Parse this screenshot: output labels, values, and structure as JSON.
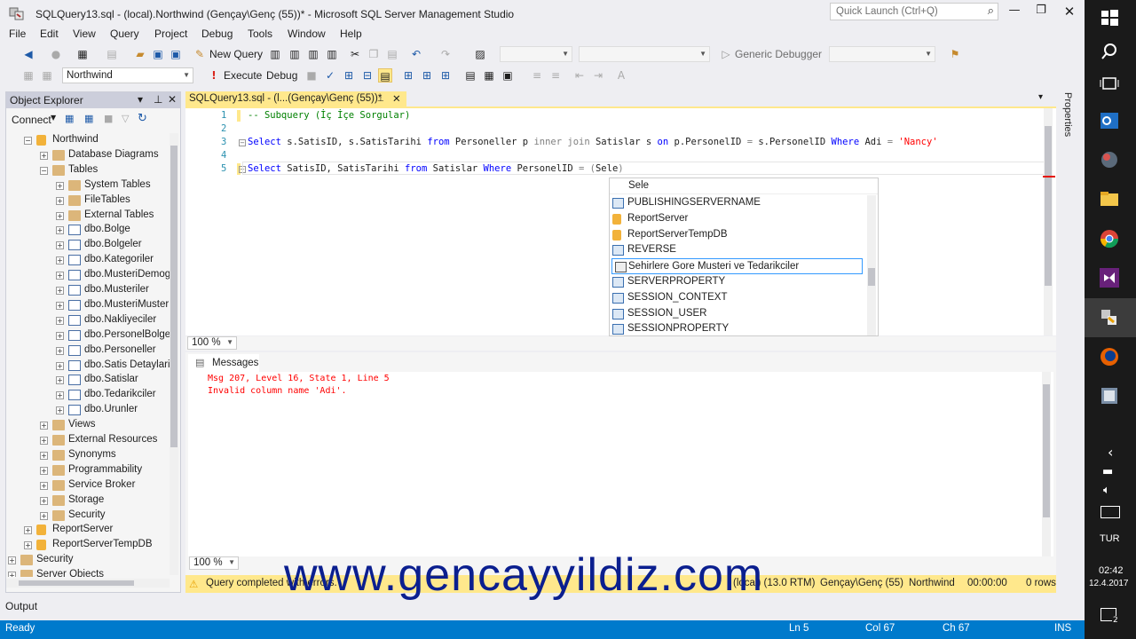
{
  "window": {
    "title": "SQLQuery13.sql - (local).Northwind (Gençay\\Genç (55))* - Microsoft SQL Server Management Studio",
    "quick_launch_placeholder": "Quick Launch (Ctrl+Q)"
  },
  "menu": [
    "File",
    "Edit",
    "View",
    "Query",
    "Project",
    "Debug",
    "Tools",
    "Window",
    "Help"
  ],
  "toolbar1": {
    "new_query": "New Query",
    "debugger": "Generic Debugger"
  },
  "toolbar2": {
    "database": "Northwind",
    "execute": "Execute",
    "debug": "Debug"
  },
  "object_explorer": {
    "title": "Object Explorer",
    "connect": "Connect",
    "tree": [
      {
        "label": "Northwind",
        "level": 1,
        "expanded": true,
        "icon": "database-icon"
      },
      {
        "label": "Database Diagrams",
        "level": 2,
        "expanded": false,
        "icon": "folder-icon"
      },
      {
        "label": "Tables",
        "level": 2,
        "expanded": true,
        "icon": "folder-icon"
      },
      {
        "label": "System Tables",
        "level": 3,
        "expanded": false,
        "icon": "folder-icon"
      },
      {
        "label": "FileTables",
        "level": 3,
        "expanded": false,
        "icon": "folder-icon"
      },
      {
        "label": "External Tables",
        "level": 3,
        "expanded": false,
        "icon": "folder-icon"
      },
      {
        "label": "dbo.Bolge",
        "level": 3,
        "expanded": false,
        "icon": "table-icon"
      },
      {
        "label": "dbo.Bolgeler",
        "level": 3,
        "expanded": false,
        "icon": "table-icon"
      },
      {
        "label": "dbo.Kategoriler",
        "level": 3,
        "expanded": false,
        "icon": "table-icon"
      },
      {
        "label": "dbo.MusteriDemog",
        "level": 3,
        "expanded": false,
        "icon": "table-icon"
      },
      {
        "label": "dbo.Musteriler",
        "level": 3,
        "expanded": false,
        "icon": "table-icon"
      },
      {
        "label": "dbo.MusteriMuster",
        "level": 3,
        "expanded": false,
        "icon": "table-icon"
      },
      {
        "label": "dbo.Nakliyeciler",
        "level": 3,
        "expanded": false,
        "icon": "table-icon"
      },
      {
        "label": "dbo.PersonelBolgel",
        "level": 3,
        "expanded": false,
        "icon": "table-icon"
      },
      {
        "label": "dbo.Personeller",
        "level": 3,
        "expanded": false,
        "icon": "table-icon"
      },
      {
        "label": "dbo.Satis Detaylari",
        "level": 3,
        "expanded": false,
        "icon": "table-icon"
      },
      {
        "label": "dbo.Satislar",
        "level": 3,
        "expanded": false,
        "icon": "table-icon"
      },
      {
        "label": "dbo.Tedarikciler",
        "level": 3,
        "expanded": false,
        "icon": "table-icon"
      },
      {
        "label": "dbo.Urunler",
        "level": 3,
        "expanded": false,
        "icon": "table-icon"
      },
      {
        "label": "Views",
        "level": 2,
        "expanded": false,
        "icon": "folder-icon"
      },
      {
        "label": "External Resources",
        "level": 2,
        "expanded": false,
        "icon": "folder-icon"
      },
      {
        "label": "Synonyms",
        "level": 2,
        "expanded": false,
        "icon": "folder-icon"
      },
      {
        "label": "Programmability",
        "level": 2,
        "expanded": false,
        "icon": "folder-icon"
      },
      {
        "label": "Service Broker",
        "level": 2,
        "expanded": false,
        "icon": "folder-icon"
      },
      {
        "label": "Storage",
        "level": 2,
        "expanded": false,
        "icon": "folder-icon"
      },
      {
        "label": "Security",
        "level": 2,
        "expanded": false,
        "icon": "folder-icon"
      },
      {
        "label": "ReportServer",
        "level": 1,
        "expanded": false,
        "icon": "database-icon"
      },
      {
        "label": "ReportServerTempDB",
        "level": 1,
        "expanded": false,
        "icon": "database-icon"
      },
      {
        "label": "Security",
        "level": 0,
        "expanded": false,
        "icon": "folder-icon"
      },
      {
        "label": "Server Objects",
        "level": 0,
        "expanded": false,
        "icon": "folder-icon"
      }
    ]
  },
  "doc_tab": "SQLQuery13.sql - (l...(Gençay\\Genç (55))*",
  "editor": {
    "line_numbers": [
      "1",
      "2",
      "3",
      "4",
      "5"
    ],
    "line1": "-- Subquery (İç İçe Sorgular)",
    "line3": {
      "select": "Select",
      "cols": " s.SatisID, s.SatisTarihi ",
      "from": "from",
      "t1": " Personeller p ",
      "inner": "inner join",
      "t2": " Satislar s ",
      "on": "on",
      "cond": " p.PersonelID ",
      "eq": "=",
      "cond2": " s.PersonelID ",
      "where": "Where",
      "col": " Adi ",
      "eq2": "=",
      "val": " 'Nancy'"
    },
    "line5": {
      "select": "Select",
      "cols": " SatisID, SatisTarihi ",
      "from": "from",
      "t": " Satislar ",
      "where": "Where",
      "col": " PersonelID ",
      "eq": "=",
      "paren": " (",
      "typed": "Sele",
      "close": ")"
    },
    "zoom": "100 %"
  },
  "autocomplete": {
    "typed": "Sele",
    "items": [
      {
        "label": "PUBLISHINGSERVERNAME",
        "icon": "function-icon",
        "selected": false
      },
      {
        "label": "ReportServer",
        "icon": "database-icon",
        "selected": false
      },
      {
        "label": "ReportServerTempDB",
        "icon": "database-icon",
        "selected": false
      },
      {
        "label": "REVERSE",
        "icon": "function-icon",
        "selected": false
      },
      {
        "label": "Sehirlere Gore Musteri ve Tedarikciler",
        "icon": "view-icon",
        "selected": true
      },
      {
        "label": "SERVERPROPERTY",
        "icon": "function-icon",
        "selected": false
      },
      {
        "label": "SESSION_CONTEXT",
        "icon": "function-icon",
        "selected": false
      },
      {
        "label": "SESSION_USER",
        "icon": "function-icon",
        "selected": false
      },
      {
        "label": "SESSIONPROPERTY",
        "icon": "function-icon",
        "selected": false
      }
    ]
  },
  "messages": {
    "tab": "Messages",
    "lines": [
      "Msg 207, Level 16, State 1, Line 5",
      "Invalid column name 'Adi'."
    ],
    "zoom": "100 %"
  },
  "query_status": {
    "text": "Query completed with errors.",
    "server": "(local) (13.0 RTM)",
    "user": "Gençay\\Genç (55)",
    "db": "Northwind",
    "time": "00:00:00",
    "rows": "0 rows"
  },
  "output_label": "Output",
  "properties_label": "Properties",
  "statusbar": {
    "ready": "Ready",
    "ln": "Ln 5",
    "col": "Col 67",
    "ch": "Ch 67",
    "ins": "INS"
  },
  "taskbar": {
    "lang": "TUR",
    "time": "02:42",
    "date": "12.4.2017",
    "notif_count": "2"
  },
  "watermark": "www.gencayyildiz.com",
  "colors": {
    "accent": "#007acc",
    "doc_tab": "#ffe88c",
    "keyword": "#0000ff",
    "comment": "#008000",
    "string": "#ff0000",
    "watermark": "#0b1f8f"
  }
}
